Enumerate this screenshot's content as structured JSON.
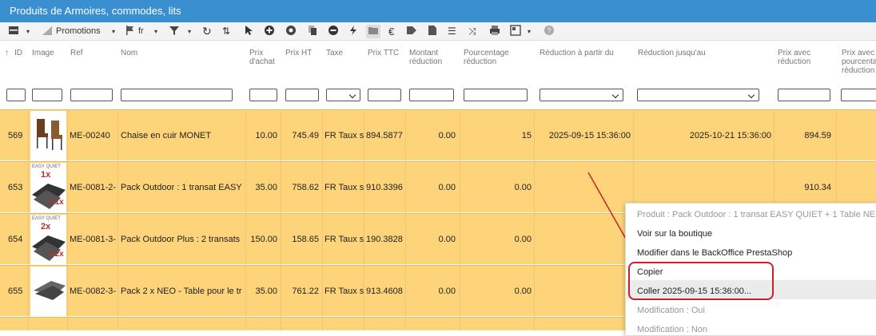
{
  "window": {
    "title": "Produits de Armoires, commodes, lits"
  },
  "toolbar": {
    "promotions_label": "Promotions",
    "lang_label": "fr",
    "icons": [
      "list-icon",
      "percent-icon",
      "flag-icon",
      "filter-icon",
      "refresh-icon",
      "swap-icon",
      "cursor-icon",
      "add-circle-icon",
      "eye-icon",
      "copy-icon",
      "minus-circle-icon",
      "lightning-icon",
      "folder-icon",
      "euro-icon",
      "tags-icon",
      "csv-icon",
      "list-ordered-icon",
      "shuffle-icon",
      "print-icon",
      "layout-icon",
      "help-icon"
    ]
  },
  "columns": {
    "id": "ID",
    "image": "Image",
    "ref": "Ref",
    "nom": "Nom",
    "prix_achat": "Prix d'achat",
    "prix_ht": "Prix HT",
    "taxe": "Taxe",
    "prix_ttc": "Prix TTC",
    "montant_reduction": "Montant réduction",
    "pourcentage_reduction": "Pourcentage réduction",
    "reduction_from": "Réduction à partir du",
    "reduction_to": "Réduction jusqu'au",
    "prix_avec_reduction": "Prix avec réduction",
    "prix_avec_pourcentage": "Prix avec pourcentage réduction"
  },
  "rows": [
    {
      "id": "569",
      "ref": "ME-00240",
      "nom": "Chaise en cuir MONET",
      "prix_achat": "10.00",
      "prix_ht": "745.49",
      "taxe": "FR Taux s",
      "prix_ttc": "894.5877",
      "montant": "0.00",
      "pourcentage": "15",
      "from": "2025-09-15 15:36:00",
      "to": "2025-10-21 15:36:00",
      "prix_red": "894.59",
      "badge": ""
    },
    {
      "id": "653",
      "ref": "ME-0081-2-",
      "nom": "Pack Outdoor : 1 transat EASY",
      "prix_achat": "35.00",
      "prix_ht": "758.62",
      "taxe": "FR Taux s",
      "prix_ttc": "910.3396",
      "montant": "0.00",
      "pourcentage": "0.00",
      "from": "",
      "to": "",
      "prix_red": "910.34",
      "badge": "1x",
      "badge2": "+ 1x",
      "badge_top": "EASY QUIET"
    },
    {
      "id": "654",
      "ref": "ME-0081-3-",
      "nom": "Pack Outdoor Plus : 2 transats",
      "prix_achat": "150.00",
      "prix_ht": "158.65",
      "taxe": "FR Taux s",
      "prix_ttc": "190.3828",
      "montant": "0.00",
      "pourcentage": "0.00",
      "from": "",
      "to": "",
      "prix_red": "",
      "badge": "2x",
      "badge2": "+ 2x",
      "badge_top": "EASY QUIET"
    },
    {
      "id": "655",
      "ref": "ME-0082-3-",
      "nom": "Pack 2 x NEO - Table pour le tr",
      "prix_achat": "35.00",
      "prix_ht": "761.22",
      "taxe": "FR Taux s",
      "prix_ttc": "913.4608",
      "montant": "0.00",
      "pourcentage": "0.00",
      "from": "",
      "to": "",
      "prix_red": "",
      "badge": ""
    }
  ],
  "context_menu": {
    "header": "Produit : Pack Outdoor : 1 transat EASY QUIET + 1 Table NE",
    "items": [
      "Voir sur la boutique",
      "Modifier dans le BackOffice PrestaShop",
      "Copier",
      "Coller 2025-09-15 15:36:00...",
      "Modification : Oui",
      "Modification : Non"
    ]
  },
  "colors": {
    "titlebar": "#3a8fd1",
    "row": "#fed47b",
    "highlight": "#c8202f"
  }
}
